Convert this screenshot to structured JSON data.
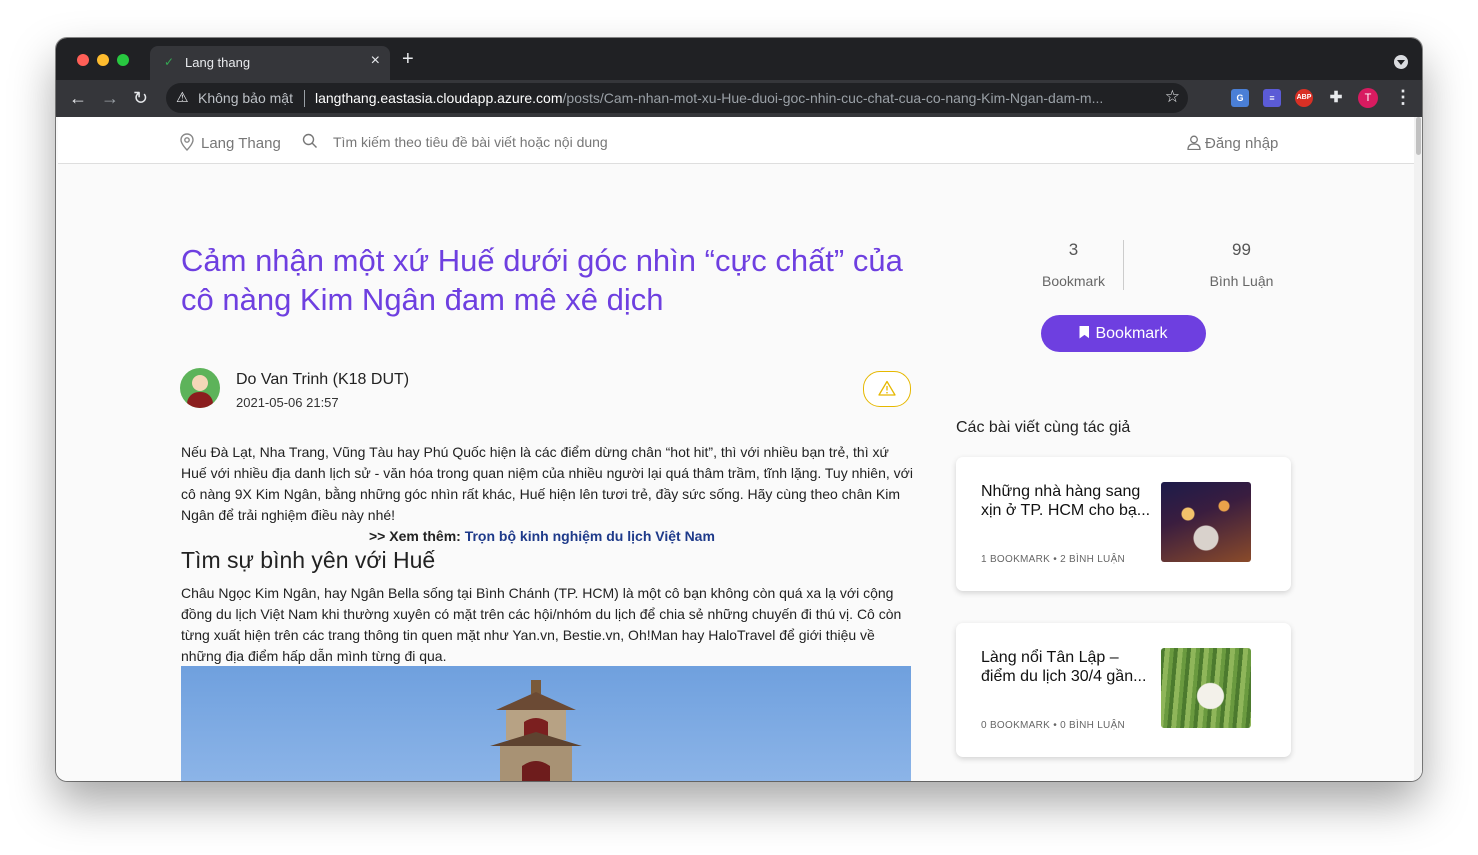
{
  "browser": {
    "tab_title": "Lang thang",
    "security_label": "Không bảo mật",
    "url_host": "langthang.eastasia.cloudapp.azure.com",
    "url_path": "/posts/Cam-nhan-mot-xu-Hue-duoi-goc-nhin-cuc-chat-cua-co-nang-Kim-Ngan-dam-m...",
    "profile_initial": "T",
    "adblock_label": "ABP"
  },
  "header": {
    "brand": "Lang Thang",
    "search_placeholder": "Tìm kiếm theo tiêu đề bài viết hoặc nội dung",
    "login": "Đăng nhập"
  },
  "post": {
    "title": "Cảm nhận một xứ Huế dưới góc nhìn “cực chất” của cô nàng Kim Ngân đam mê xê dịch",
    "author": "Do Van Trinh (K18 DUT)",
    "date": "2021-05-06 21:57",
    "intro": "Nếu  Đà Lạt, Nha Trang, Vũng Tàu hay Phú Quốc hiện là các điểm dừng chân “hot hit”, thì với nhiều bạn trẻ, thì xứ Huế với nhiều địa danh lịch sử - văn hóa trong quan niệm của nhiều người lại quá thâm trầm, tĩnh lặng. Tuy nhiên, với cô nàng 9X Kim Ngân, bằng những góc nhìn rất khác, Huế hiện lên tươi trẻ, đầy sức sống. Hãy cùng theo chân Kim Ngân để trải nghiệm điều này nhé!",
    "see_more_prefix": ">> Xem thêm: ",
    "see_more_link": "Trọn bộ kinh nghiệm du lịch Việt Nam",
    "section_heading": "Tìm sự bình yên với Huế",
    "paragraph": "Châu Ngọc Kim Ngân, hay Ngân Bella sống tại Bình Chánh (TP. HCM) là một cô bạn không còn quá xa lạ với cộng đồng du lịch Việt Nam khi thường xuyên có mặt trên các hội/nhóm du lịch để chia sẻ những chuyến đi thú vị. Cô còn từng xuất hiện trên các trang thông tin quen mặt như Yan.vn, Bestie.vn, Oh!Man hay HaloTravel để giới thiệu về những địa điểm hấp dẫn mình từng đi qua."
  },
  "sidebar": {
    "bookmark_count": "3",
    "bookmark_label": "Bookmark",
    "comment_count": "99",
    "comment_label": "Bình Luận",
    "bookmark_button": "Bookmark",
    "related_title": "Các bài viết cùng tác giả",
    "cards": [
      {
        "title": "Những nhà hàng sang xịn ở TP. HCM cho bạ...",
        "meta": "1 BOOKMARK  •  2 BÌNH LUẬN"
      },
      {
        "title": "Làng nổi Tân Lập – điểm du lịch 30/4 gần...",
        "meta": "0 BOOKMARK  •  0 BÌNH LUẬN"
      }
    ]
  },
  "icons": {
    "brand": "map-pin-icon",
    "search": "search-icon",
    "login": "user-icon",
    "report": "warning-icon",
    "bookmark": "bookmark-icon"
  },
  "colors": {
    "accent": "#6e3fe0",
    "link": "#1e3a8a",
    "warning": "#e6b800"
  }
}
